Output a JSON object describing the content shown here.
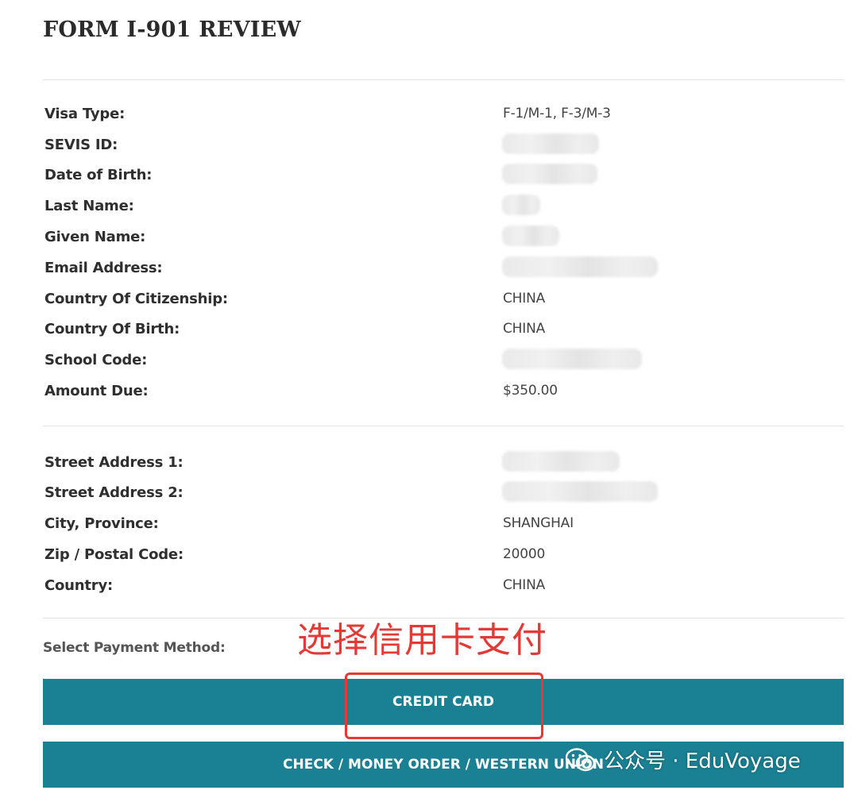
{
  "form": {
    "title": "FORM I-901 REVIEW",
    "details": [
      {
        "label": "Visa Type:",
        "value": "F-1/M-1, F-3/M-3"
      },
      {
        "label": "SEVIS ID:",
        "value": ""
      },
      {
        "label": "Date of Birth:",
        "value": ""
      },
      {
        "label": "Last Name:",
        "value": ""
      },
      {
        "label": "Given Name:",
        "value": ""
      },
      {
        "label": "Email Address:",
        "value": ""
      },
      {
        "label": "Country Of Citizenship:",
        "value": "CHINA"
      },
      {
        "label": "Country Of Birth:",
        "value": "CHINA"
      },
      {
        "label": "School Code:",
        "value": ""
      },
      {
        "label": "Amount Due:",
        "value": "$350.00"
      }
    ],
    "address": [
      {
        "label": "Street Address 1:",
        "value": ""
      },
      {
        "label": "Street Address 2:",
        "value": ""
      },
      {
        "label": "City, Province:",
        "value": "SHANGHAI"
      },
      {
        "label": "Zip / Postal Code:",
        "value": "20000"
      },
      {
        "label": "Country:",
        "value": "CHINA"
      }
    ]
  },
  "payment": {
    "label": "Select Payment Method:",
    "credit_card_label": "CREDIT CARD",
    "check_label": "CHECK / MONEY ORDER / WESTERN UNION"
  },
  "annotation": {
    "text": "选择信用卡支付",
    "color": "#e53935"
  },
  "watermark": {
    "text": "公众号 · EduVoyage",
    "icon": "wechat-icon"
  },
  "colors": {
    "button": "#1a8093",
    "highlight": "#e53935"
  }
}
